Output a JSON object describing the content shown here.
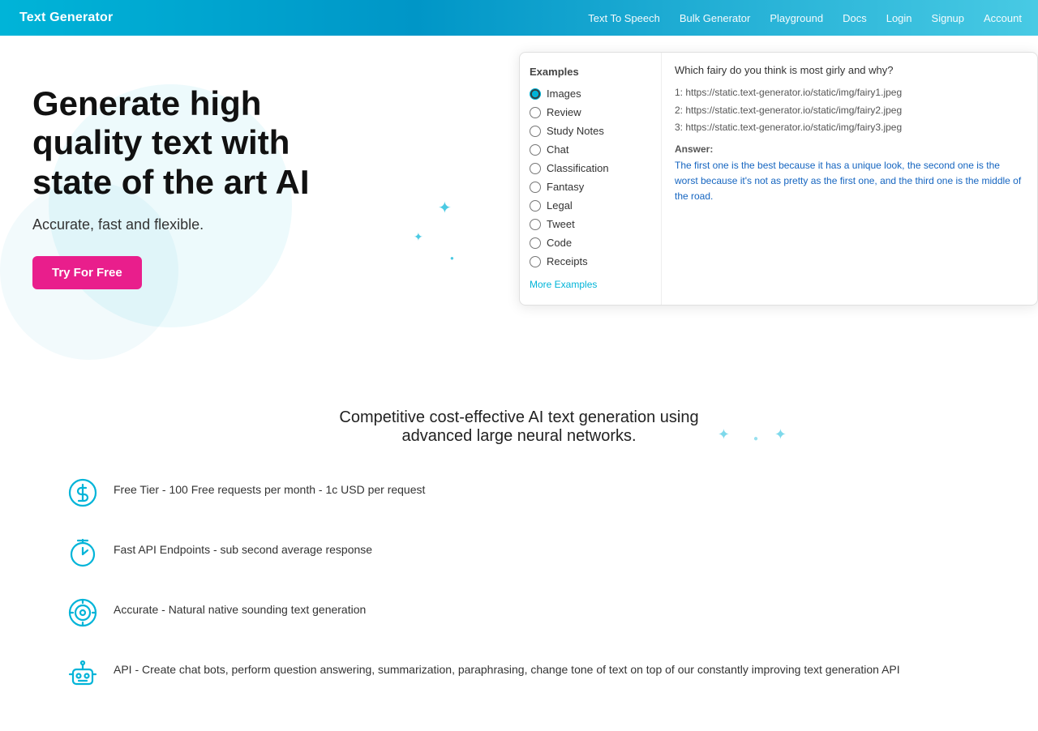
{
  "header": {
    "logo": "Text Generator",
    "nav": [
      {
        "label": "Text To Speech",
        "href": "#"
      },
      {
        "label": "Bulk Generator",
        "href": "#"
      },
      {
        "label": "Playground",
        "href": "#"
      },
      {
        "label": "Docs",
        "href": "#"
      },
      {
        "label": "Login",
        "href": "#"
      },
      {
        "label": "Signup",
        "href": "#"
      },
      {
        "label": "Account",
        "href": "#"
      }
    ]
  },
  "hero": {
    "title": "Generate high quality text with state of the art AI",
    "subtitle": "Accurate, fast and flexible.",
    "cta_button": "Try For Free"
  },
  "examples": {
    "section_title": "Examples",
    "options": [
      {
        "label": "Images",
        "value": "images",
        "checked": true
      },
      {
        "label": "Review",
        "value": "review"
      },
      {
        "label": "Study Notes",
        "value": "study-notes"
      },
      {
        "label": "Chat",
        "value": "chat"
      },
      {
        "label": "Classification",
        "value": "classification"
      },
      {
        "label": "Fantasy",
        "value": "fantasy"
      },
      {
        "label": "Legal",
        "value": "legal"
      },
      {
        "label": "Tweet",
        "value": "tweet"
      },
      {
        "label": "Code",
        "value": "code"
      },
      {
        "label": "Receipts",
        "value": "receipts"
      }
    ],
    "more_link": "More Examples",
    "content": {
      "question": "Which fairy do you think is most girly and why?",
      "urls": [
        "1: https://static.text-generator.io/static/img/fairy1.jpeg",
        "2: https://static.text-generator.io/static/img/fairy2.jpeg",
        "3: https://static.text-generator.io/static/img/fairy3.jpeg"
      ],
      "answer_label": "Answer:",
      "answer_text": "The first one is the best because it has a unique look, the second one is the worst because it's not as pretty as the first one, and the third one is the middle of the road."
    }
  },
  "features": {
    "headline": "Competitive cost-effective AI text generation using advanced large neural networks.",
    "items": [
      {
        "icon": "dollar",
        "text": "Free Tier - 100 Free requests per month - 1c USD per request"
      },
      {
        "icon": "timer",
        "text": "Fast API Endpoints - sub second average response"
      },
      {
        "icon": "target",
        "text": "Accurate - Natural native sounding text generation"
      },
      {
        "icon": "robot",
        "text": "API - Create chat bots, perform question answering, summarization, paraphrasing, change tone of text on top of our constantly improving text generation API"
      }
    ]
  }
}
